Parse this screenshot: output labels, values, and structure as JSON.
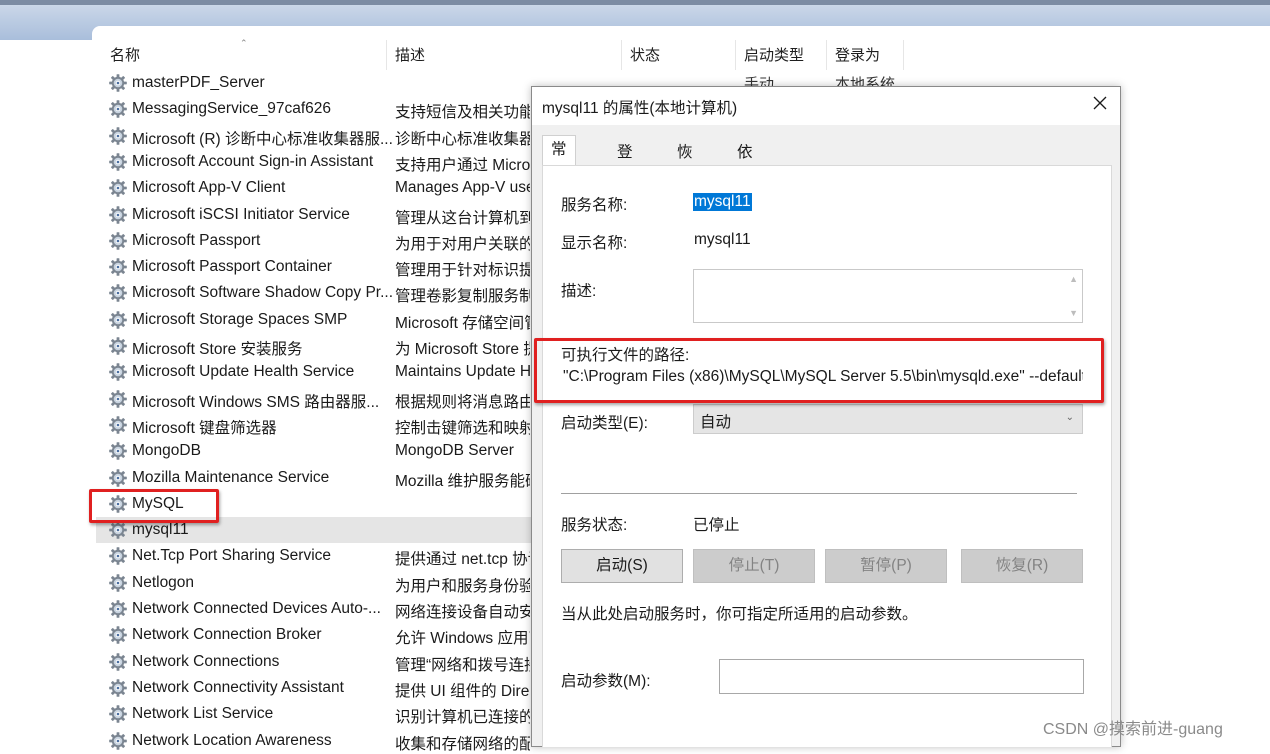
{
  "columns": {
    "name": "名称",
    "description": "描述",
    "status": "状态",
    "startup_type": "启动类型",
    "logon_as": "登录为"
  },
  "partial_row": {
    "startup_type": "手动",
    "logon_as": "本地系统"
  },
  "services": [
    {
      "name": "masterPDF_Server",
      "desc": ""
    },
    {
      "name": "MessagingService_97caf626",
      "desc": "支持短信及相关功能"
    },
    {
      "name": "Microsoft (R) 诊断中心标准收集器服...",
      "desc": "诊断中心标准收集器"
    },
    {
      "name": "Microsoft Account Sign-in Assistant",
      "desc": "支持用户通过 Micros"
    },
    {
      "name": "Microsoft App-V Client",
      "desc": "Manages App-V use"
    },
    {
      "name": "Microsoft iSCSI Initiator Service",
      "desc": "管理从这台计算机到"
    },
    {
      "name": "Microsoft Passport",
      "desc": "为用于对用户关联的"
    },
    {
      "name": "Microsoft Passport Container",
      "desc": "管理用于针对标识提"
    },
    {
      "name": "Microsoft Software Shadow Copy Pr...",
      "desc": "管理卷影复制服务制"
    },
    {
      "name": "Microsoft Storage Spaces SMP",
      "desc": "Microsoft 存储空间管"
    },
    {
      "name": "Microsoft Store 安装服务",
      "desc": "为 Microsoft Store 提"
    },
    {
      "name": "Microsoft Update Health Service",
      "desc": "Maintains Update H"
    },
    {
      "name": "Microsoft Windows SMS 路由器服...",
      "desc": "根据规则将消息路由"
    },
    {
      "name": "Microsoft 键盘筛选器",
      "desc": "控制击键筛选和映射"
    },
    {
      "name": "MongoDB",
      "desc": "MongoDB Server"
    },
    {
      "name": "Mozilla Maintenance Service",
      "desc": "Mozilla 维护服务能确"
    },
    {
      "name": "MySQL",
      "desc": ""
    },
    {
      "name": "mysql11",
      "desc": ""
    },
    {
      "name": "Net.Tcp Port Sharing Service",
      "desc": "提供通过 net.tcp 协议"
    },
    {
      "name": "Netlogon",
      "desc": "为用户和服务身份验"
    },
    {
      "name": "Network Connected Devices Auto-...",
      "desc": "网络连接设备自动安"
    },
    {
      "name": "Network Connection Broker",
      "desc": "允许 Windows 应用商"
    },
    {
      "name": "Network Connections",
      "desc": "管理“网络和拨号连接"
    },
    {
      "name": "Network Connectivity Assistant",
      "desc": "提供 UI 组件的 Direc"
    },
    {
      "name": "Network List Service",
      "desc": "识别计算机已连接的"
    },
    {
      "name": "Network Location Awareness",
      "desc": "收集和存储网络的配"
    }
  ],
  "dialog": {
    "title": "mysql11 的属性(本地计算机)",
    "tabs": [
      "常规",
      "登录",
      "恢复",
      "依存关系"
    ],
    "service_name_label": "服务名称:",
    "service_name_value": "mysql11",
    "display_name_label": "显示名称:",
    "display_name_value": "mysql11",
    "description_label": "描述:",
    "path_label": "可执行文件的路径:",
    "path_value": "\"C:\\Program Files (x86)\\MySQL\\MySQL Server 5.5\\bin\\mysqld.exe\" --defaults-file",
    "startup_type_label": "启动类型(E):",
    "startup_type_value": "自动",
    "status_label": "服务状态:",
    "status_value": "已停止",
    "buttons": {
      "start": "启动(S)",
      "stop": "停止(T)",
      "pause": "暂停(P)",
      "resume": "恢复(R)"
    },
    "hint": "当从此处启动服务时，你可指定所适用的启动参数。",
    "params_label": "启动参数(M):"
  },
  "watermark": "CSDN @摸索前进-guang",
  "colors": {
    "highlight": "#e02020",
    "selection": "#0078d7"
  }
}
